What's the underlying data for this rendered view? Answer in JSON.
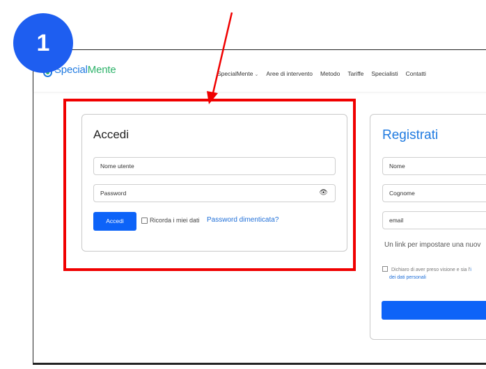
{
  "step_badge": "1",
  "logo": {
    "part1": "Special",
    "part2": "Mente"
  },
  "nav": {
    "items": [
      "SpecialMente",
      "Aree di intervento",
      "Metodo",
      "Tariffe",
      "Specialisti",
      "Contatti"
    ]
  },
  "login": {
    "title": "Accedi",
    "username_placeholder": "Nome utente",
    "password_placeholder": "Password",
    "submit_label": "Accedi",
    "remember_label": "Ricorda i miei dati",
    "forgot_label": "Password dimenticata?"
  },
  "register": {
    "title": "Registrati",
    "name_placeholder": "Nome",
    "surname_placeholder": "Cognome",
    "email_placeholder": "email",
    "note": "Un link per impostare una nuov",
    "consent_text": "Dichiaro di aver preso visione e sia l'",
    "consent_link": "i",
    "consent_line2": "dei dati personali"
  },
  "colors": {
    "accent": "#0d63f8",
    "highlight": "#f00000",
    "badge": "#1e5ef0",
    "link": "#1f6fd8"
  }
}
